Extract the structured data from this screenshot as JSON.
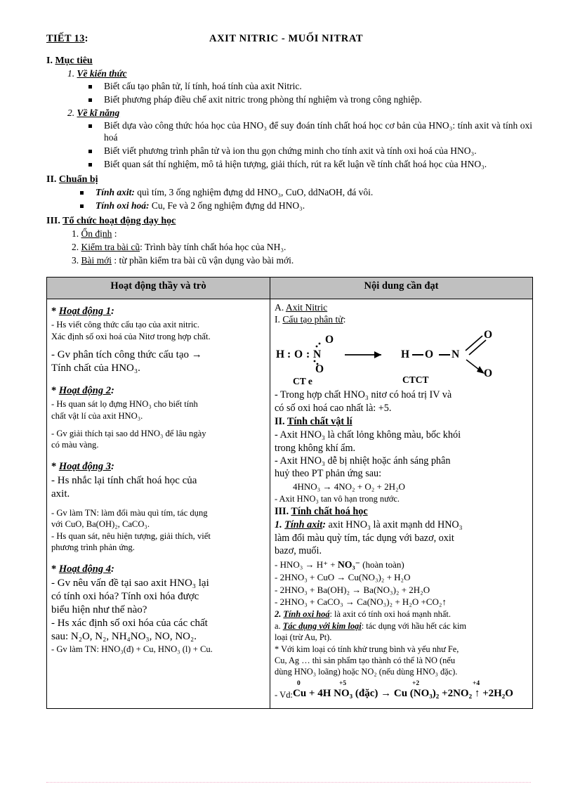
{
  "header": {
    "lesson_label": "TIẾT  13",
    "lesson_label_suffix": ":",
    "title": "AXIT  NITRIC - MUỐI NITRAT"
  },
  "section_1": {
    "heading_num": "I.",
    "heading": "Mục tiêu",
    "sub_1": {
      "num": "1.",
      "label": "Về kiến thức"
    },
    "sub_1_items": [
      "Biết cấu tạo phân tử, lí tính, hoá tính  của axit  Nitric.",
      "Biết phương pháp điều chế axit nitric  trong phòng thí nghiệm  và trong công nghiệp."
    ],
    "sub_2": {
      "num": "2.",
      "label": "Về kĩ năng"
    },
    "sub_2_items": [
      "Biết dựa vào công thức hóa học của HNO₃ để suy đoán tính  chất hoá học cơ bản của HNO₃: tính  axit và tính  oxi hoá",
      "Biết viết phương trình  phân tử và ion  thu gọn chứng minh  cho tính  axit và tính  oxi hoá của HNO₃.",
      "Biết quan sát thí nghiệm,  mô tả hiện  tượng, giải  thích,  rút ra kết luận  về tính  chất hoá học của HNO₃."
    ]
  },
  "section_2": {
    "heading_num": "II.",
    "heading": "Chuẩn bị",
    "items": [
      {
        "lead": "Tính axit:",
        "text": " quì tím,  3 ống nghiệm   đựng dd HNO₃, CuO, ddNaOH, đá vôi."
      },
      {
        "lead": "Tính oxi hoá:",
        "text": " Cu, Fe và 2 ống nghiệm   đựng dd HNO₃."
      }
    ]
  },
  "section_3": {
    "heading_num": "III.",
    "heading": "Tổ chức hoạt động dạy học",
    "items": [
      {
        "num": "1.",
        "label": "Ổn định",
        "text": " :"
      },
      {
        "num": "2.",
        "label": "Kiểm tra bài cũ",
        "text": ": Trình  bày tính  chất hóa học của NH₃."
      },
      {
        "num": "3.",
        "label": "Bài mới",
        "text": " : từ phần kiểm  tra bài cũ vận dụng vào bài mới."
      }
    ]
  },
  "table": {
    "header_left": "Hoạt động thầy và trò",
    "header_right": "Nội dung cần đạt",
    "left_column": [
      {
        "type": "activity",
        "star": "*",
        "label": "Hoạt động 1",
        "colon": ":"
      },
      {
        "type": "small",
        "text": "- Hs viết  công thức cấu tạo của axit nitric."
      },
      {
        "type": "small",
        "text": "Xác định  số oxi hoá của Nitơ trong hợp chất."
      },
      {
        "type": "gap"
      },
      {
        "type": "big",
        "text": "- Gv phân tích công thức cấu tạo →"
      },
      {
        "type": "big",
        "text": "Tính chất của HNO₃."
      },
      {
        "type": "gap"
      },
      {
        "type": "activity",
        "star": "*",
        "label": "Hoạt động 2",
        "colon": ":"
      },
      {
        "type": "small",
        "text": "- Hs quan sát lọ đựng HNO₃  cho biết tính"
      },
      {
        "type": "small",
        "text": "chất vật lí  của axit  HNO₃."
      },
      {
        "type": "gap"
      },
      {
        "type": "small",
        "text": "- Gv giải  thích  tại sao dd HNO₃ để lâu ngày"
      },
      {
        "type": "small",
        "text": "có màu vàng."
      },
      {
        "type": "gap"
      },
      {
        "type": "activity",
        "star": "*",
        "label": "Hoạt động 3",
        "colon": ":"
      },
      {
        "type": "big",
        "text": "- Hs nhắc lại tính chất hoá học của"
      },
      {
        "type": "big",
        "text": "axit."
      },
      {
        "type": "gap"
      },
      {
        "type": "small",
        "text": "- Gv làm  TN: làm  đổi màu  quì tím,  tác dụng"
      },
      {
        "type": "small",
        "text": "với  CuO, Ba(OH)₂, CaCO₃."
      },
      {
        "type": "small",
        "text": "- Hs quan sát, nêu hiện  tượng, giải  thích,  viết"
      },
      {
        "type": "small",
        "text": "phương trình  phản ứng."
      },
      {
        "type": "gap"
      },
      {
        "type": "activity",
        "star": "*",
        "label": "Hoạt động 4",
        "colon": ":"
      },
      {
        "type": "big",
        "text": "- Gv nêu vấn đề tại sao axit HNO₃ lại"
      },
      {
        "type": "big",
        "text": "có tính oxi hóa? Tính oxi hóa được"
      },
      {
        "type": "big",
        "text": "biểu hiện như thế nào?"
      },
      {
        "type": "big",
        "text": "- Hs xác định số oxi hóa của các chất"
      },
      {
        "type": "big",
        "text": "sau: N₂O, N₂, NH₄NO₃, NO, NO₂."
      },
      {
        "type": "small",
        "text": "- Gv làm  TN: HNO₃(đ)  + Cu, HNO₃ (l) + Cu."
      }
    ],
    "right_column": {
      "part_a": {
        "prefix": "A.",
        "label": "Axit Nitric"
      },
      "part_i": {
        "prefix": "I.",
        "label": "Cấu tạo phân tử",
        "colon": ":"
      },
      "structure": {
        "left_formula": {
          "h": "H",
          "colon1": ":",
          "o": "O",
          "colon2": ":",
          "n": "N",
          "o_top": "O",
          "o_bottom": "O",
          "caption": "CT e"
        },
        "right_formula": {
          "h": "H",
          "o": "O",
          "n": "N",
          "o_top": "O",
          "o_bottom": "O",
          "caption": "CTCT"
        }
      },
      "valence_text_1": "- Trong hợp chất HNO₃ nitơ có hoá trị IV và",
      "valence_text_2": "có số oxi hoá cao nhất là:  +5.",
      "part_ii": {
        "prefix": "II.",
        "label": "Tính chất vật lí"
      },
      "phys_lines": [
        "- Axit  HNO₃ là chất lỏng không màu, bốc khói",
        "trong không khí ẩm.",
        "- Axit  HNO₃ dễ bị nhiệt hoặc ánh sáng phân",
        "huỷ theo PT phản ứng sau:"
      ],
      "decomposition_eq": "4HNO₃   →  4NO₂ +  O₂  +  2H₂O",
      "solubility_line": "- Axit  HNO₃ tan vô hạn trong nước.",
      "part_iii": {
        "prefix": "III.",
        "label": "Tính chất hoá học"
      },
      "acid_prop": {
        "num": "1.",
        "label": "Tính axit",
        "colon": ":"
      },
      "acid_lines": [
        " axit HNO₃ là axit mạnh  dd HNO₃",
        "làm  đổi màu quỳ tím, tác dụng với  bazơ, oxit",
        "bazơ, muối."
      ],
      "ionization": {
        "left": "- HNO₃  → H⁺  + ",
        "ion": "NO₃⁻",
        "right": " (hoàn toàn)"
      },
      "reactions": [
        "- 2HNO₃  + CuO → Cu(NO₃)₂ + H₂O",
        "- 2HNO₃  + Ba(OH)₂ → Ba(NO₃)₂ + 2H₂O",
        "- 2HNO₃  + CaCO₃ → Ca(NO₃)₂ + H₂O +CO₂↑"
      ],
      "oxi_prop": {
        "num": "2.",
        "label": "Tính oxi hoá",
        "text": ": là axit  có tính  oxi hoá mạnh  nhất."
      },
      "metal_prop": {
        "prefix": "a.",
        "label": "Tác dụng với kim loại",
        "text": ": tác dụng với  hầu hết các kim"
      },
      "metal_lines": [
        "loại (trừ Au, Pt).",
        "* Với kim  loại có tính  khử trung  bình  và yếu như Fe,",
        "Cu, Ag … thì sản phẩm tạo thành có thể là NO (nếu",
        "dùng  HNO₃ loãng)  hoặc NO₂ (nếu  dùng  HNO₃ đặc)."
      ],
      "example": {
        "lead": "- Vd:",
        "equation": "Cu + 4H NO₃ (đặc) → Cu (NO₃)₂ +2NO₂ ↑ +2H₂O",
        "oxidation_numbers": [
          "0",
          "+5",
          "+2",
          "+4"
        ]
      }
    }
  }
}
